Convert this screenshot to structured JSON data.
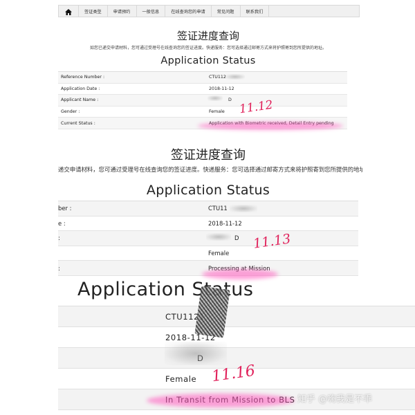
{
  "nav": {
    "items": [
      "签证类型",
      "申请预约",
      "一般信息",
      "在线查询您的申请",
      "常见问题",
      "联系我们"
    ]
  },
  "panel1": {
    "title": "签证进度查询",
    "subtitle": "如您已递交申请材料，您可通过受理号在线查询您的签证进度。快递服务：您可选择通过邮寄方式来将护照寄到您所提供的地址。",
    "heading": "Application Status",
    "rows": [
      {
        "label": "Reference Number :",
        "value": "CTU112"
      },
      {
        "label": "Application Date :",
        "value": "2018-11-12"
      },
      {
        "label": "Applicant Name :",
        "value": "D"
      },
      {
        "label": "Gender :",
        "value": "Female"
      },
      {
        "label": "Current Status :",
        "value": "Application with Biometric received, Detail Entry pending"
      }
    ],
    "note": "11.12"
  },
  "panel2": {
    "title": "签证进度查询",
    "subtitle": "递交申请材料，您可通过受理号在线查询您的签证进度。快递服务：您可选择通过邮寄方式来将护照寄到您所提供的地址。",
    "heading": "Application Status",
    "rows": [
      {
        "label": "ber :",
        "value": "CTU11"
      },
      {
        "label": "e :",
        "value": "2018-11-12"
      },
      {
        "label": ":",
        "value": "D"
      },
      {
        "label": "",
        "value": "Female"
      },
      {
        "label": ":",
        "value": "Processing at Mission"
      }
    ],
    "note": "11.13"
  },
  "panel3": {
    "heading": "Application Status",
    "rows": [
      {
        "value": "CTU1121"
      },
      {
        "value": "2018-11-12"
      },
      {
        "value": "D"
      },
      {
        "value": "Female"
      },
      {
        "value": "In Transit from Mission to BLS"
      }
    ],
    "note": "11.16"
  },
  "watermark": "知乎 @嗨我是不乖",
  "colors": {
    "annotation": "#e0205a",
    "highlight": "#ff5abe"
  }
}
